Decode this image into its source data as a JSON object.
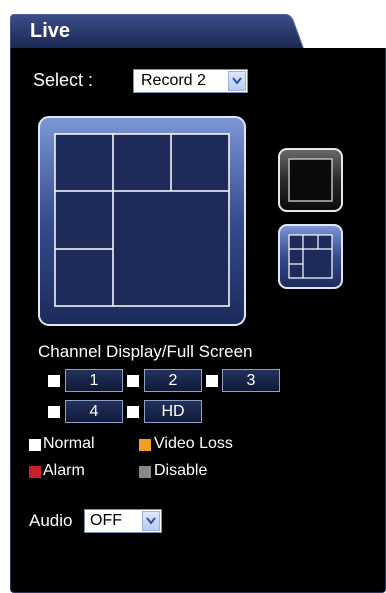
{
  "tab": {
    "title": "Live"
  },
  "select": {
    "label": "Select :",
    "value": "Record 2"
  },
  "channels": {
    "title": "Channel Display/Full Screen",
    "buttons": [
      "1",
      "2",
      "3",
      "4",
      "HD"
    ]
  },
  "legend": [
    {
      "label": "Normal",
      "color": "#ffffff"
    },
    {
      "label": "Video Loss",
      "color": "#f0a020"
    },
    {
      "label": "Alarm",
      "color": "#c8202a"
    },
    {
      "label": "Disable",
      "color": "#8a8a8a"
    }
  ],
  "audio": {
    "label": "Audio",
    "value": "OFF"
  }
}
